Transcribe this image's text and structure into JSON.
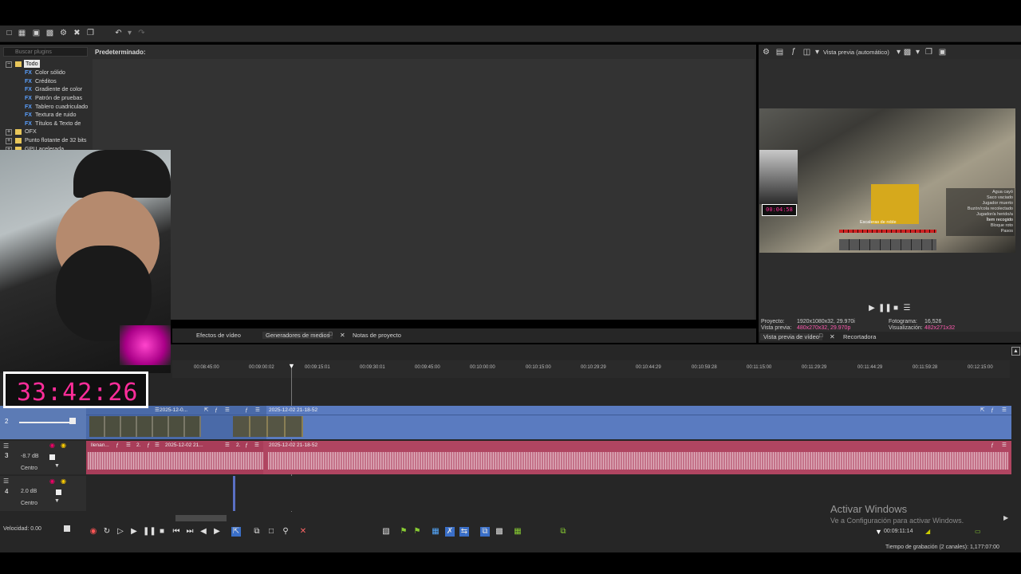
{
  "toolbar": {
    "icons": [
      "new-icon",
      "open-icon",
      "save-icon",
      "save-as-icon",
      "settings-icon",
      "cut-icon",
      "copy-icon",
      "undo-icon",
      "redo-icon"
    ]
  },
  "plugins": {
    "search_placeholder": "Buscar plugins",
    "preset_label": "Predeterminado:",
    "tree": [
      {
        "label": "Todo",
        "level": 0,
        "type": "folder",
        "expanded": true,
        "selected": true
      },
      {
        "label": "Color sólido",
        "level": 1,
        "type": "fx"
      },
      {
        "label": "Créditos",
        "level": 1,
        "type": "fx"
      },
      {
        "label": "Gradiente de color",
        "level": 1,
        "type": "fx"
      },
      {
        "label": "Patrón de pruebas",
        "level": 1,
        "type": "fx"
      },
      {
        "label": "Tablero cuadriculado",
        "level": 1,
        "type": "fx"
      },
      {
        "label": "Textura de ruido",
        "level": 1,
        "type": "fx"
      },
      {
        "label": "Títulos & Texto de",
        "level": 1,
        "type": "fx"
      },
      {
        "label": "OFX",
        "level": 0,
        "type": "folder"
      },
      {
        "label": "Punto flotante de 32 bits",
        "level": 0,
        "type": "folder"
      },
      {
        "label": "GPU acelerada",
        "level": 0,
        "type": "folder"
      }
    ]
  },
  "left_tabs": {
    "video_effects": "Efectos de vídeo",
    "media_generators": "Generadores de medios",
    "project_notes": "Notas de proyecto"
  },
  "preview": {
    "mode": "Vista previa (automático)",
    "project_label": "Proyecto:",
    "project_value": "1920x1080x32, 29.970i",
    "preview_label": "Vista previa:",
    "preview_value": "480x270x32, 29.970p",
    "frame_label": "Fotograma:",
    "frame_value": "16,526",
    "display_label": "Visualización:",
    "display_value": "482x271x32",
    "game_text": [
      "Agua cayó",
      "Saco vaciado",
      "Jugador muerto",
      "Buzón/cola recolectado",
      "Jugador/a herido/a",
      "Ítem recogido",
      "Bloque roto",
      "Pasos"
    ],
    "game_title": "Escaleras de roble",
    "cam_timer": "00:04:58"
  },
  "right_tabs": {
    "video_preview": "Vista previa de vídeo",
    "trimmer": "Recortadora"
  },
  "ruler": {
    "labels": [
      "00:08:45:00",
      "00:09:00:02",
      "00:09:15:01",
      "00:09:30:01",
      "00:09:45:00",
      "00:10:00:00",
      "00:10:15:00",
      "00:10:29:29",
      "00:10:44:29",
      "00:10:59:28",
      "00:11:15:00",
      "00:11:29:29",
      "00:11:44:29",
      "00:11:59:28",
      "00:12:15:00"
    ]
  },
  "tracks": {
    "video_clip1": "2025-12-0...",
    "video_clip2": "2025-12-02 21-18-52",
    "audio_clip0": "llenan...",
    "audio_clip1": "2025-12-02 21...",
    "audio_clip_small": "2.",
    "audio_clip2": "2025-12-02 21-18-52",
    "audio1_volume": "-8.7 dB",
    "audio1_pan": "Centro",
    "audio2_volume": "2.0 dB",
    "audio2_pan": "Centro",
    "track2_num": "2",
    "track3_num": "3",
    "track4_num": "4"
  },
  "transport": {
    "speed": "Velocidad: 0.00",
    "time": "00:09:11:14"
  },
  "status": {
    "record_time": "Tiempo de grabación (2 canales): 1,177:07:00"
  },
  "overlay": {
    "timer": "33:42:26",
    "watermark_title": "Activar Windows",
    "watermark_sub": "Ve a Configuración para activar Windows."
  }
}
